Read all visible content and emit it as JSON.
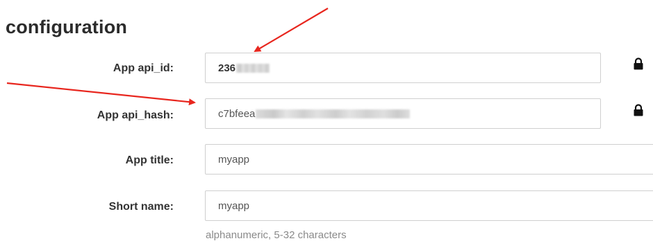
{
  "section_title": "configuration",
  "fields": {
    "api_id": {
      "label": "App api_id:",
      "value_visible": "236",
      "value_obscured": true,
      "locked": true,
      "icon": "lock-icon"
    },
    "api_hash": {
      "label": "App api_hash:",
      "value_visible": "c7bfeea",
      "value_obscured": true,
      "locked": true,
      "icon": "lock-icon"
    },
    "app_title": {
      "label": "App title:",
      "value": "myapp"
    },
    "short_name": {
      "label": "Short name:",
      "value": "myapp",
      "hint": "alphanumeric, 5-32 characters"
    }
  },
  "annotation_arrows": {
    "color": "#e8261e",
    "count": 2
  },
  "colors": {
    "border": "#cfcfcf",
    "label": "#333333",
    "hint": "#8a8a8a",
    "arrow": "#e8261e"
  }
}
